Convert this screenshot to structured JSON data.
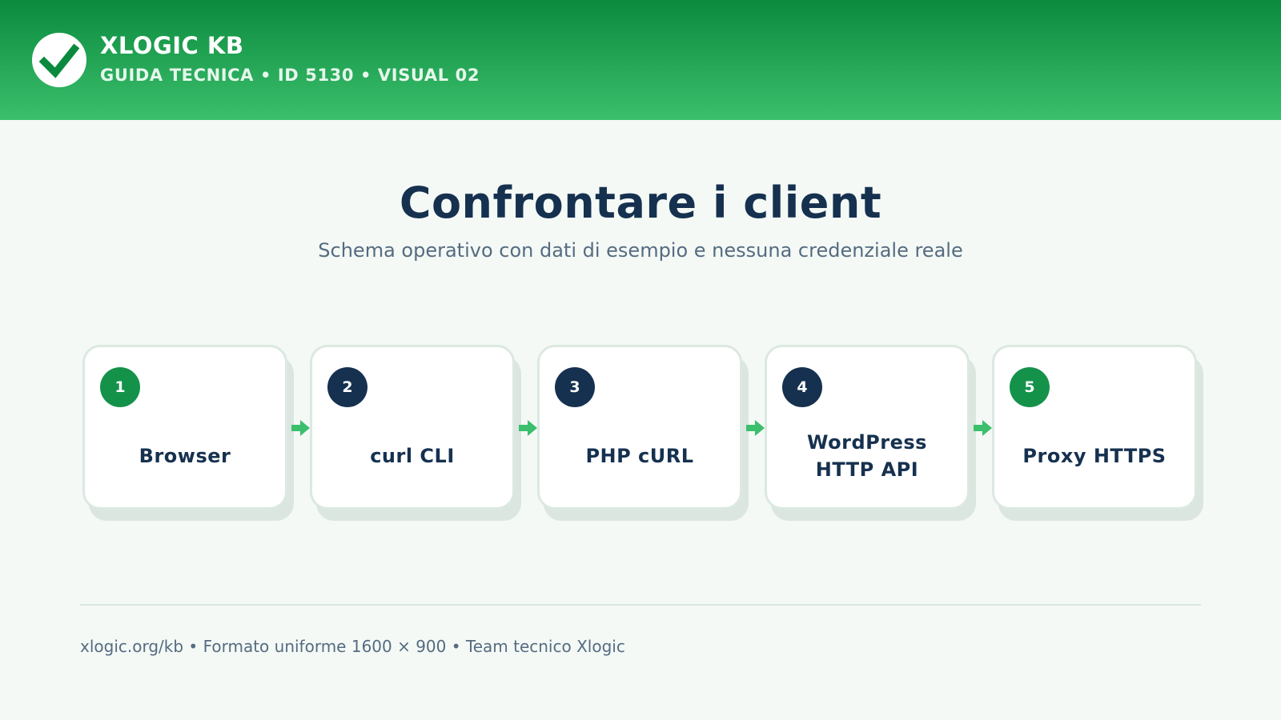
{
  "header": {
    "brand": "XLOGIC KB",
    "subtitle": "GUIDA TECNICA • ID 5130 • VISUAL 02",
    "logo_icon": "check-icon",
    "color_start": "#0b8a3e",
    "color_end": "#3bbf6c"
  },
  "main": {
    "title": "Confrontare i client",
    "subtitle": "Schema operativo con dati di esempio e nessuna credenziale reale"
  },
  "steps": [
    {
      "number": "1",
      "label": "Browser",
      "badge_color": "#14924a"
    },
    {
      "number": "2",
      "label": "curl CLI",
      "badge_color": "#16314f"
    },
    {
      "number": "3",
      "label": "PHP cURL",
      "badge_color": "#16314f"
    },
    {
      "number": "4",
      "label": "WordPress\nHTTP API",
      "badge_color": "#16314f"
    },
    {
      "number": "5",
      "label": "Proxy HTTPS",
      "badge_color": "#14924a"
    }
  ],
  "arrow_icon": "arrow-right-icon",
  "arrow_color": "#3bbf6c",
  "footer": {
    "text": "xlogic.org/kb • Formato uniforme 1600 × 900 • Team tecnico Xlogic"
  }
}
